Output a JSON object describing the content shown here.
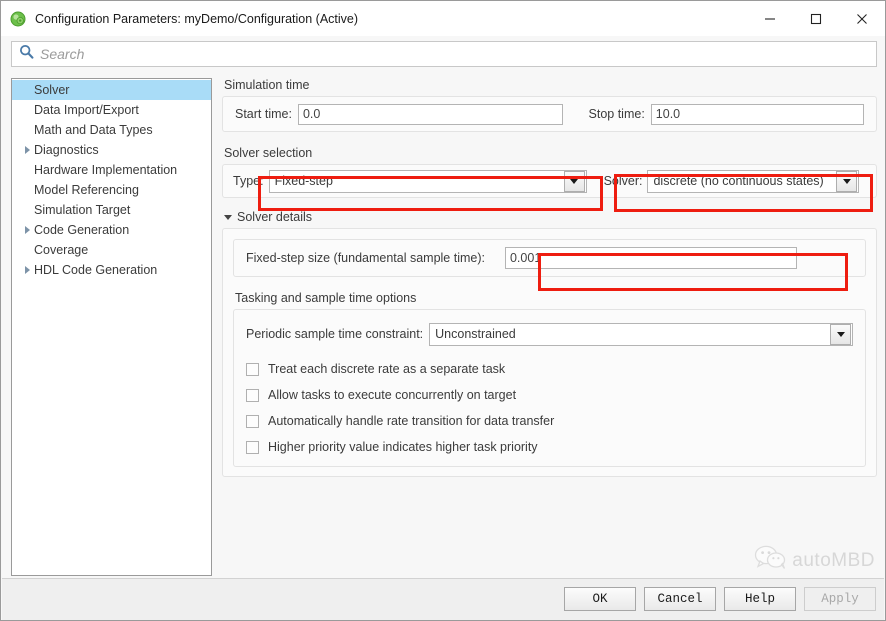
{
  "window": {
    "title": "Configuration Parameters: myDemo/Configuration (Active)",
    "app_icon": "simulink-config-icon",
    "minimize_label": "—",
    "maximize_label": "□",
    "close_label": "✕"
  },
  "search": {
    "placeholder": "Search",
    "value": "",
    "icon": "search-icon"
  },
  "tree": {
    "items": [
      {
        "label": "Solver",
        "expandable": false,
        "selected": true
      },
      {
        "label": "Data Import/Export",
        "expandable": false,
        "selected": false
      },
      {
        "label": "Math and Data Types",
        "expandable": false,
        "selected": false
      },
      {
        "label": "Diagnostics",
        "expandable": true,
        "selected": false
      },
      {
        "label": "Hardware Implementation",
        "expandable": false,
        "selected": false
      },
      {
        "label": "Model Referencing",
        "expandable": false,
        "selected": false
      },
      {
        "label": "Simulation Target",
        "expandable": false,
        "selected": false
      },
      {
        "label": "Code Generation",
        "expandable": true,
        "selected": false
      },
      {
        "label": "Coverage",
        "expandable": false,
        "selected": false
      },
      {
        "label": "HDL Code Generation",
        "expandable": true,
        "selected": false
      }
    ]
  },
  "simulation_time": {
    "group_label": "Simulation time",
    "start_label": "Start time:",
    "start_value": "0.0",
    "stop_label": "Stop time:",
    "stop_value": "10.0"
  },
  "solver_selection": {
    "group_label": "Solver selection",
    "type_label": "Type:",
    "type_value": "Fixed-step",
    "solver_label": "Solver:",
    "solver_value": "discrete (no continuous states)"
  },
  "solver_details": {
    "section_label": "Solver details",
    "fixed_step_label": "Fixed-step size (fundamental sample time):",
    "fixed_step_value": "0.001",
    "tasking_label": "Tasking and sample time options",
    "periodic_label": "Periodic sample time constraint:",
    "periodic_value": "Unconstrained",
    "checkboxes": [
      {
        "label": "Treat each discrete rate as a separate task",
        "checked": false
      },
      {
        "label": "Allow tasks to execute concurrently on target",
        "checked": false
      },
      {
        "label": "Automatically handle rate transition for data transfer",
        "checked": false
      },
      {
        "label": "Higher priority value indicates higher task priority",
        "checked": false
      }
    ]
  },
  "footer": {
    "ok": "OK",
    "cancel": "Cancel",
    "help": "Help",
    "apply": "Apply",
    "apply_disabled": true
  },
  "watermark": {
    "text": "autoMBD",
    "icon": "wechat-icon"
  },
  "colors": {
    "annotation": "#ee1d10",
    "selection": "#a9dcf7",
    "accent": "#4a7aa8"
  }
}
